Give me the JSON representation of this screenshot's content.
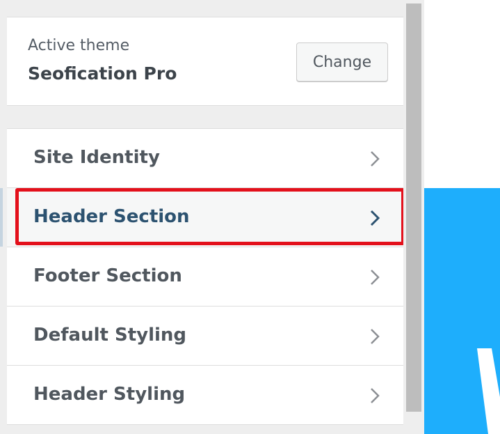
{
  "theme": {
    "caption": "Active theme",
    "name": "Seofication Pro",
    "change_label": "Change"
  },
  "menu": {
    "items": [
      {
        "label": "Site Identity",
        "icon": "chevron-right-icon"
      },
      {
        "label": "Header Section",
        "icon": "chevron-right-icon"
      },
      {
        "label": "Footer Section",
        "icon": "chevron-right-icon"
      },
      {
        "label": "Default Styling",
        "icon": "chevron-right-icon"
      },
      {
        "label": "Header Styling",
        "icon": "chevron-right-icon"
      }
    ],
    "active_index": 1
  },
  "preview": {
    "partial_text": "W"
  },
  "colors": {
    "highlight": "#e3101b",
    "preview_bg": "#1eaefc",
    "active_chevron": "#2c5270",
    "chevron": "#8c8f94"
  }
}
